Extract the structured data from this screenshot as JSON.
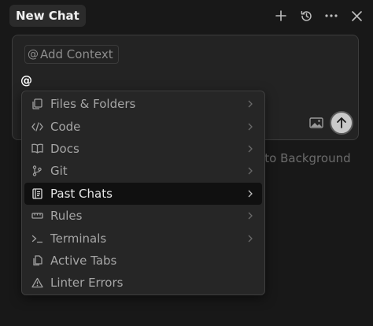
{
  "header": {
    "title": "New Chat",
    "actions": [
      "plus-icon",
      "history-icon",
      "more-icon",
      "close-icon"
    ]
  },
  "composer": {
    "add_context_label": "Add Context",
    "add_context_icon": "@",
    "typed_text": "@",
    "image_icon": "image-icon",
    "send_icon": "arrow-up-icon"
  },
  "background_hint": "d to Background",
  "mention_menu": {
    "items": [
      {
        "label": "Files & Folders",
        "icon": "files-icon",
        "has_submenu": true
      },
      {
        "label": "Code",
        "icon": "code-icon",
        "has_submenu": true
      },
      {
        "label": "Docs",
        "icon": "book-icon",
        "has_submenu": true
      },
      {
        "label": "Git",
        "icon": "git-branch-icon",
        "has_submenu": true
      },
      {
        "label": "Past Chats",
        "icon": "document-icon",
        "has_submenu": true,
        "selected": true
      },
      {
        "label": "Rules",
        "icon": "ruler-icon",
        "has_submenu": true
      },
      {
        "label": "Terminals",
        "icon": "terminal-icon",
        "has_submenu": true
      },
      {
        "label": "Active Tabs",
        "icon": "copy-icon",
        "has_submenu": false
      },
      {
        "label": "Linter Errors",
        "icon": "warning-icon",
        "has_submenu": false
      }
    ]
  },
  "colors": {
    "background": "#181818",
    "composer_bg": "#232323",
    "menu_bg": "#262626",
    "selected_bg": "#101010",
    "send_button": "#c9c9c9"
  }
}
